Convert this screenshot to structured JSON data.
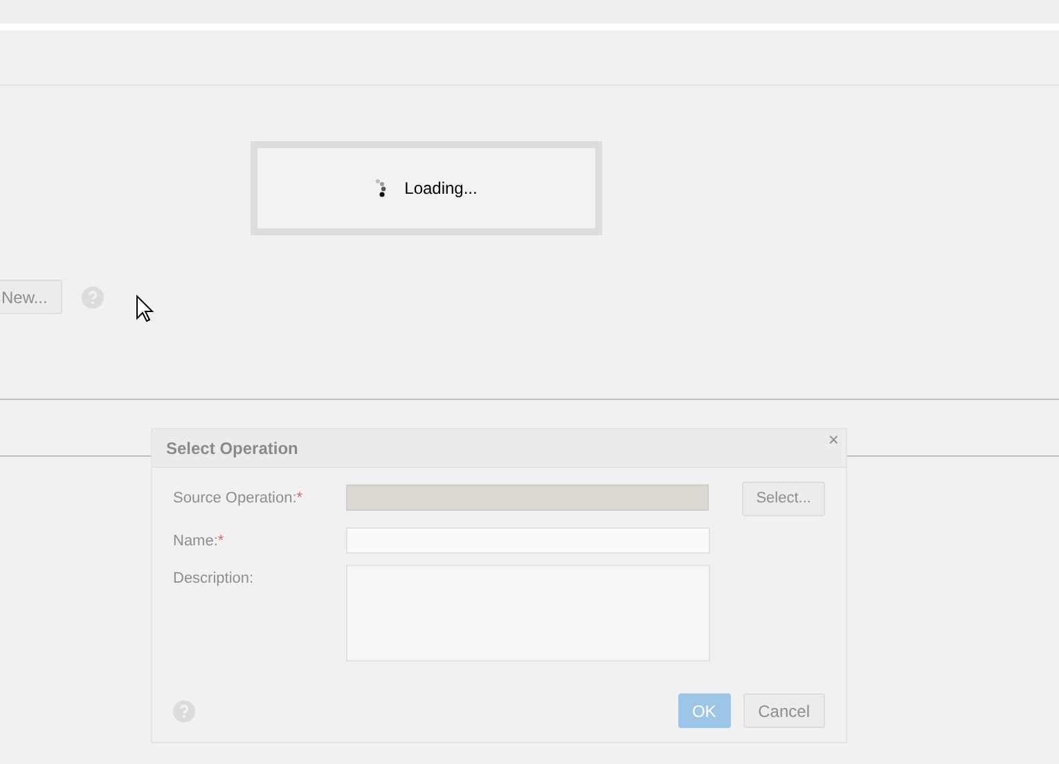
{
  "loading": {
    "text": "Loading..."
  },
  "page": {
    "new_button": "New..."
  },
  "dialog": {
    "title": "Select Operation",
    "close": "×",
    "required_mark": "*",
    "fields": [
      {
        "kind": "input",
        "label": "Source Operation:",
        "required": true,
        "readonly": true,
        "button": "Select..."
      },
      {
        "kind": "input",
        "label": "Name:",
        "required": true,
        "readonly": false
      },
      {
        "kind": "textarea",
        "label": "Description:",
        "required": false,
        "readonly": false
      }
    ],
    "buttons": [
      {
        "label": "OK",
        "primary": true
      },
      {
        "label": "Cancel",
        "primary": false
      }
    ]
  }
}
